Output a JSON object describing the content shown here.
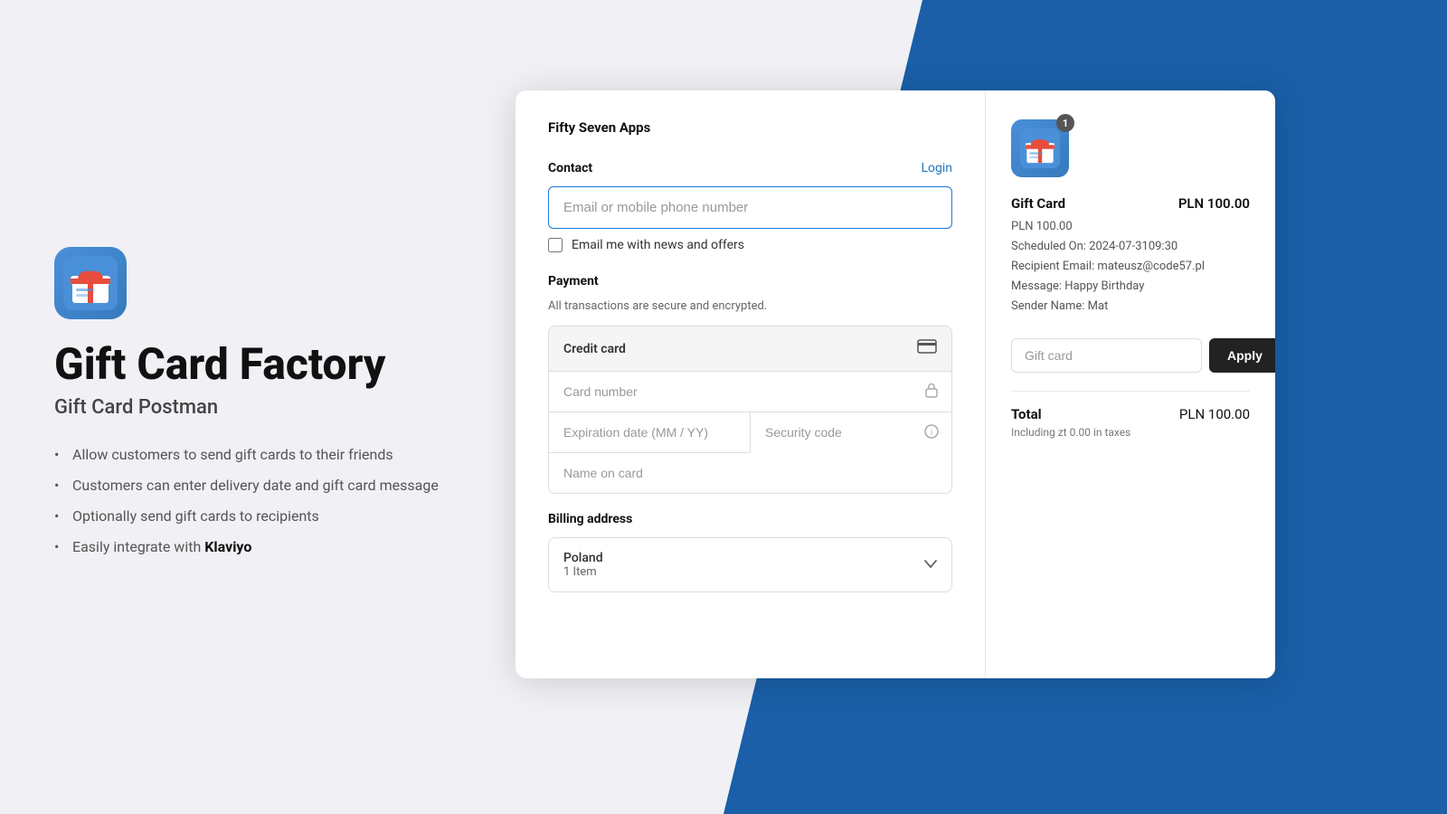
{
  "background": {
    "left_color": "#f0f0f5",
    "right_color": "#1a5fa8"
  },
  "left_panel": {
    "app_icon_alt": "gift-card-factory-icon",
    "app_title": "Gift Card Factory",
    "app_subtitle": "Gift Card Postman",
    "features": [
      {
        "text": "Allow customers to send gift cards to their friends"
      },
      {
        "text": "Customers can enter delivery date and gift card message"
      },
      {
        "text": "Optionally send gift cards to recipients"
      },
      {
        "text": "Easily integrate with ",
        "bold": "Klaviyo"
      }
    ]
  },
  "checkout": {
    "store_name": "Fifty Seven Apps",
    "contact": {
      "label": "Contact",
      "login_label": "Login",
      "email_placeholder": "Email or mobile phone number",
      "email_value": "",
      "checkbox_label": "Email me with news and offers"
    },
    "payment": {
      "label": "Payment",
      "note": "All transactions are secure and encrypted.",
      "method_label": "Credit card",
      "card_number_placeholder": "Card number",
      "expiry_placeholder": "Expiration date (MM / YY)",
      "security_placeholder": "Security code",
      "name_placeholder": "Name on card"
    },
    "billing": {
      "label": "Billing address",
      "country": "Poland",
      "item_count": "1 Item"
    }
  },
  "summary": {
    "badge_count": "1",
    "product_name": "Gift Card",
    "product_price": "PLN 100.00",
    "meta_line1": "PLN 100.00",
    "meta_line2": "Scheduled On: 2024-07-3109:30",
    "meta_line3": "Recipient Email: mateusz@code57.pl",
    "meta_line4": "Message: Happy Birthday",
    "meta_line5": "Sender Name: Mat",
    "gift_card_placeholder": "Gift card",
    "apply_label": "Apply",
    "total_label": "Total",
    "total_currency": "PLN",
    "total_amount": "100.00",
    "tax_note": "Including zt 0.00 in taxes"
  }
}
